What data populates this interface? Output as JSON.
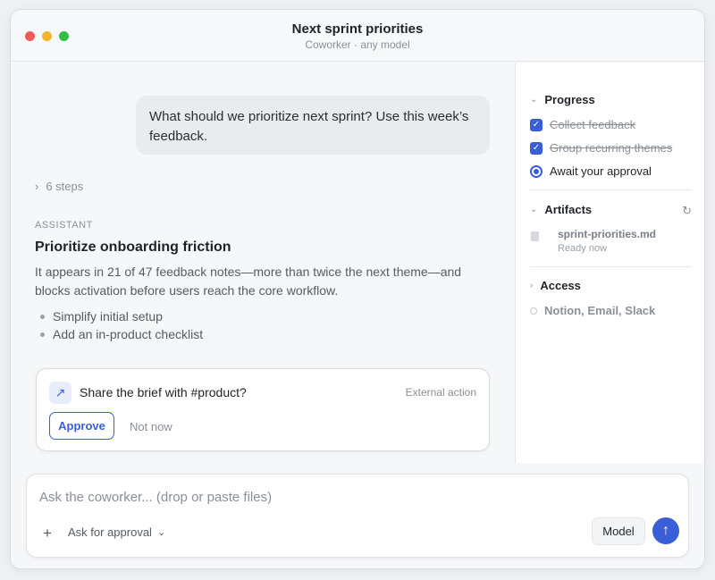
{
  "window": {
    "title": "Next sprint priorities",
    "subtitle": "Coworker · any model"
  },
  "chat": {
    "user_message": "What should we prioritize next sprint? Use this week’s feedback.",
    "steps_label": "6 steps",
    "assistant_label": "ASSISTANT",
    "heading": "Prioritize onboarding friction",
    "paragraph": "It appears in 21 of 47 feedback notes—more than twice the next theme—and blocks activation before users reach the core workflow.",
    "bullets": [
      "Simplify initial setup",
      "Add an in-product checklist"
    ]
  },
  "action_card": {
    "icon": "arrow-up-right-icon",
    "title": "Share the brief with #product?",
    "tag": "External action",
    "approve_label": "Approve",
    "not_now_label": "Not now"
  },
  "sidebar": {
    "progress": {
      "title": "Progress",
      "items": [
        {
          "label": "Collect feedback",
          "state": "done"
        },
        {
          "label": "Group recurring themes",
          "state": "done"
        },
        {
          "label": "Await your approval",
          "state": "current"
        }
      ]
    },
    "artifacts": {
      "title": "Artifacts",
      "file_name": "sprint-priorities.md",
      "file_status": "Ready now"
    },
    "access": {
      "title": "Access",
      "value": "Notion, Email, Slack"
    }
  },
  "composer": {
    "placeholder": "Ask the coworker... (drop or paste files)",
    "approval_label": "Ask for approval",
    "model_label": "Model"
  },
  "colors": {
    "accent": "#3a5ed8",
    "close": "#ee5b55",
    "minimize": "#f2b42d",
    "maximize": "#2fbf45"
  }
}
